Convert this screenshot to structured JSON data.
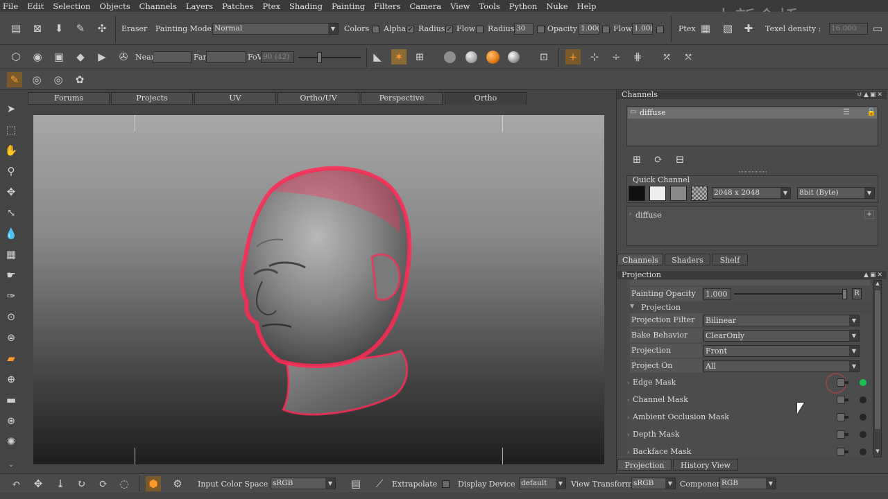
{
  "menu": [
    "File",
    "Edit",
    "Selection",
    "Objects",
    "Channels",
    "Layers",
    "Patches",
    "Ptex",
    "Shading",
    "Painting",
    "Filters",
    "Camera",
    "View",
    "Tools",
    "Python",
    "Nuke",
    "Help"
  ],
  "watermark": "中新金桥",
  "toolbar1": {
    "tool_name": "Eraser",
    "painting_mode_label": "Painting Mode",
    "painting_mode_value": "Normal",
    "colors_label": "Colors",
    "alpha_label": "Alpha",
    "radius_toggle_label": "Radius",
    "flow_toggle_label": "Flow",
    "radius_label": "Radius",
    "radius_value": "30",
    "opacity_label": "Opacity",
    "opacity_value": "1.00(",
    "flow_label": "Flow",
    "flow_value": "1.00(",
    "ptex_label": "Ptex",
    "texel_density_label": "Texel density :",
    "texel_density_value": "16.000"
  },
  "toolbar2": {
    "near_label": "Near",
    "far_label": "Far",
    "fov_label": "FoV",
    "fov_value": "90 (42)"
  },
  "viewport_tabs": [
    "Forums",
    "Projects",
    "UV",
    "Ortho/UV",
    "Perspective",
    "Ortho"
  ],
  "viewport_active_tab": "Ortho",
  "channels_panel": {
    "title": "Channels",
    "channel_name": "diffuse",
    "quick_channel_label": "Quick Channel",
    "resolution": "2048 x 2048",
    "depth": "8bit (Byte)",
    "quick_item": "diffuse",
    "tabs": [
      "Channels",
      "Shaders",
      "Shelf"
    ]
  },
  "projection_panel": {
    "title": "Projection",
    "painting_opacity_label": "Painting Opacity",
    "painting_opacity_value": "1.000",
    "r_button": "R",
    "section_label": "Projection",
    "rows": [
      {
        "label": "Projection Filter",
        "value": "Bilinear"
      },
      {
        "label": "Bake Behavior",
        "value": "ClearOnly"
      },
      {
        "label": "Projection",
        "value": "Front"
      },
      {
        "label": "Project On",
        "value": "All"
      }
    ],
    "masks": [
      "Edge Mask",
      "Channel Mask",
      "Ambient Occlusion Mask",
      "Depth Mask",
      "Backface Mask"
    ],
    "tabs": [
      "Projection",
      "History View"
    ]
  },
  "bottom": {
    "input_color_space_label": "Input Color Space",
    "input_color_space_value": "sRGB",
    "extrapolate_label": "Extrapolate",
    "display_device_label": "Display Device",
    "display_device_value": "default",
    "view_transform_label": "View Transform",
    "view_transform_value": "sRGB",
    "component_label": "Component",
    "component_value": "RGB"
  },
  "colors": {
    "accent_orange": "#e07a1a",
    "edge_mask_on": "#1ec44b",
    "head_rim": "#ff2a55"
  }
}
